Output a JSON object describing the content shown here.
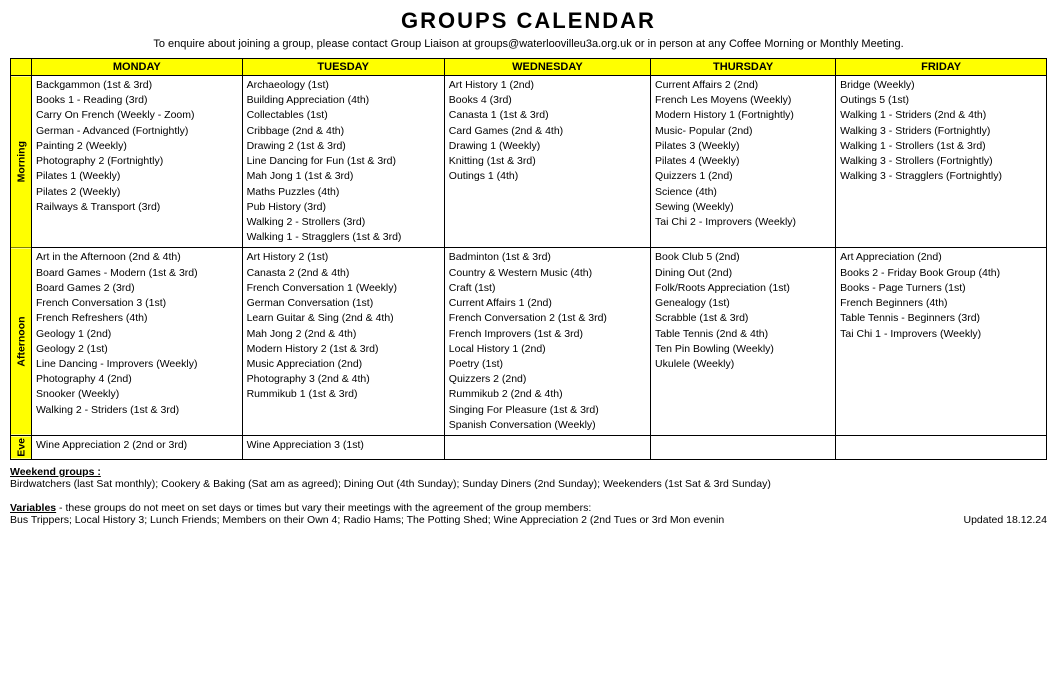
{
  "title": "GROUPS CALENDAR",
  "subtitle": "To enquire about joining a group, please contact Group Liaison at groups@waterloovilleu3a.org.uk or in person at any Coffee Morning or Monthly Meeting.",
  "headers": {
    "col0": "",
    "monday": "MONDAY",
    "tuesday": "TUESDAY",
    "wednesday": "WEDNESDAY",
    "thursday": "THURSDAY",
    "friday": "FRIDAY"
  },
  "morning": {
    "label": "Morning",
    "monday": [
      "Backgammon (1st & 3rd)",
      "Books 1 - Reading (3rd)",
      "Carry On French (Weekly - Zoom)",
      "German - Advanced (Fortnightly)",
      "Painting 2  (Weekly)",
      "Photography 2 (Fortnightly)",
      "Pilates 1 (Weekly)",
      "Pilates 2  (Weekly)",
      "Railways & Transport (3rd)"
    ],
    "tuesday": [
      "Archaeology (1st)",
      "Building Appreciation (4th)",
      "Collectables (1st)",
      "Cribbage (2nd & 4th)",
      "Drawing 2 (1st & 3rd)",
      "Line Dancing for Fun (1st & 3rd)",
      "Mah Jong 1 (1st & 3rd)",
      "Maths Puzzles (4th)",
      "Pub History (3rd)",
      "Walking 2 - Strollers (3rd)",
      "Walking 1 - Stragglers (1st & 3rd)"
    ],
    "wednesday": [
      "Art History 1 (2nd)",
      "Books 4 (3rd)",
      "Canasta 1 (1st & 3rd)",
      "Card Games (2nd & 4th)",
      "Drawing 1 (Weekly)",
      "Knitting  (1st & 3rd)",
      "Outings 1 (4th)"
    ],
    "thursday": [
      "Current Affairs 2 (2nd)",
      "French Les Moyens (Weekly)",
      "Modern History 1 (Fortnightly)",
      "Music- Popular (2nd)",
      "Pilates 3 (Weekly)",
      "Pilates 4 (Weekly)",
      "Quizzers 1 (2nd)",
      "Science (4th)",
      "Sewing (Weekly)",
      "Tai Chi 2 - Improvers (Weekly)"
    ],
    "friday": [
      "Bridge (Weekly)",
      "Outings 5 (1st)",
      "Walking 1 - Striders (2nd & 4th)",
      "Walking 3 - Striders (Fortnightly)",
      "Walking 1 - Strollers  (1st & 3rd)",
      "Walking 3 - Strollers (Fortnightly)",
      "Walking 3 - Stragglers (Fortnightly)"
    ]
  },
  "afternoon": {
    "label": "Afternoon",
    "monday": [
      "Art in the Afternoon (2nd & 4th)",
      "Board Games - Modern (1st & 3rd)",
      "Board Games 2 (3rd)",
      "French Conversation 3 (1st)",
      "French Refreshers (4th)",
      "Geology 1 (2nd)",
      "Geology 2 (1st)",
      "Line Dancing - Improvers (Weekly)",
      "Photography 4 (2nd)",
      "Snooker  (Weekly)",
      "Walking 2 - Striders (1st & 3rd)"
    ],
    "tuesday": [
      "Art History 2 (1st)",
      "Canasta 2 (2nd & 4th)",
      "French Conversation 1 (Weekly)",
      "German Conversation (1st)",
      "Learn Guitar & Sing (2nd & 4th)",
      "Mah Jong 2 (2nd & 4th)",
      "Modern History 2 (1st & 3rd)",
      "Music Appreciation (2nd)",
      "Photography 3 (2nd & 4th)",
      "Rummikub 1 (1st & 3rd)"
    ],
    "wednesday": [
      "Badminton (1st & 3rd)",
      "Country & Western Music (4th)",
      "Craft (1st)",
      "Current Affairs 1 (2nd)",
      "French Conversation 2  (1st & 3rd)",
      "French Improvers (1st & 3rd)",
      "Local History 1 (2nd)",
      "Poetry (1st)",
      "Quizzers 2 (2nd)",
      "Rummikub 2  (2nd & 4th)",
      "Singing For Pleasure (1st & 3rd)",
      "Spanish Conversation (Weekly)"
    ],
    "thursday": [
      "Book Club 5 (2nd)",
      "Dining Out (2nd)",
      "Folk/Roots Appreciation (1st)",
      "Genealogy (1st)",
      "Scrabble (1st & 3rd)",
      "Table Tennis (2nd & 4th)",
      "Ten Pin Bowling (Weekly)",
      "Ukulele (Weekly)"
    ],
    "friday": [
      "Art Appreciation (2nd)",
      "Books 2 - Friday Book Group (4th)",
      "Books - Page Turners (1st)",
      "French Beginners (4th)",
      "Table Tennis - Beginners (3rd)",
      "Tai Chi 1 - Improvers (Weekly)"
    ]
  },
  "evening": {
    "label": "Eve",
    "monday": [
      "Wine Appreciation 2 (2nd or 3rd)"
    ],
    "tuesday": [
      "Wine Appreciation 3 (1st)"
    ],
    "wednesday": [],
    "thursday": [],
    "friday": []
  },
  "footer": {
    "weekend_label": "Weekend groups :",
    "weekend_text": "Birdwatchers (last Sat monthly); Cookery & Baking (Sat am as agreed); Dining Out (4th Sunday); Sunday Diners (2nd Sunday); Weekenders (1st Sat & 3rd Sunday)",
    "variables_label": "Variables",
    "variables_text": " - these groups do not meet on set days or times but vary their meetings with the agreement of the group members:",
    "variables_detail": "Bus Trippers;  Local History 3; Lunch Friends; Members on their Own 4; Radio Hams; The Potting Shed; Wine Appreciation 2 (2nd Tues or 3rd Mon evenin",
    "updated": "Updated 18.12.24"
  }
}
